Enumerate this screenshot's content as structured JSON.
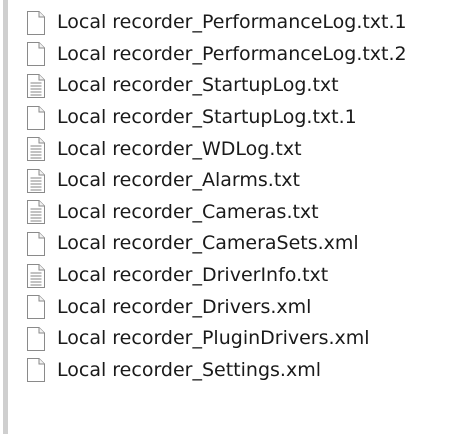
{
  "files": [
    {
      "name": "Local recorder_PerformanceLog.txt.1",
      "icon": "blank-file-icon"
    },
    {
      "name": "Local recorder_PerformanceLog.txt.2",
      "icon": "blank-file-icon"
    },
    {
      "name": "Local recorder_StartupLog.txt",
      "icon": "text-file-icon"
    },
    {
      "name": "Local recorder_StartupLog.txt.1",
      "icon": "blank-file-icon"
    },
    {
      "name": "Local recorder_WDLog.txt",
      "icon": "text-file-icon"
    },
    {
      "name": "Local recorder_Alarms.txt",
      "icon": "text-file-icon"
    },
    {
      "name": "Local recorder_Cameras.txt",
      "icon": "text-file-icon"
    },
    {
      "name": "Local recorder_CameraSets.xml",
      "icon": "blank-file-icon"
    },
    {
      "name": "Local recorder_DriverInfo.txt",
      "icon": "text-file-icon"
    },
    {
      "name": "Local recorder_Drivers.xml",
      "icon": "blank-file-icon"
    },
    {
      "name": "Local recorder_PluginDrivers.xml",
      "icon": "blank-file-icon"
    },
    {
      "name": "Local recorder_Settings.xml",
      "icon": "blank-file-icon"
    }
  ]
}
